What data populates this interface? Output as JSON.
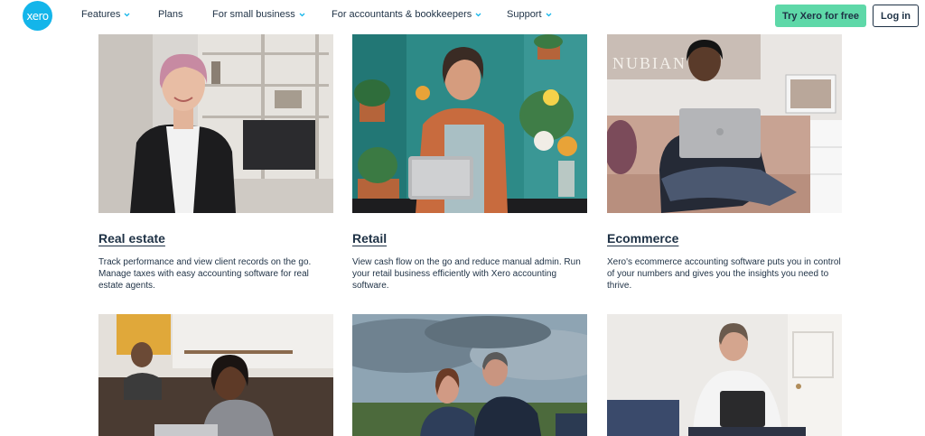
{
  "nav": {
    "logo": "xero",
    "items": [
      {
        "label": "Features",
        "has_dropdown": true
      },
      {
        "label": "Plans",
        "has_dropdown": false
      },
      {
        "label": "For small business",
        "has_dropdown": true
      },
      {
        "label": "For accountants & bookkeepers",
        "has_dropdown": true
      },
      {
        "label": "Support",
        "has_dropdown": true
      }
    ],
    "try_button": "Try Xero for free",
    "login_button": "Log in"
  },
  "cards": [
    {
      "title": "Real estate",
      "description": "Track performance and view client records on the go. Manage taxes with easy accounting software for real estate agents."
    },
    {
      "title": "Retail",
      "description": "View cash flow on the go and reduce manual admin. Run your retail business efficiently with Xero accounting software."
    },
    {
      "title": "Ecommerce",
      "description": "Xero's ecommerce accounting software puts you in control of your numbers and gives you the insights you need to thrive.",
      "image_sign_text": "NUBIAN"
    }
  ],
  "colors": {
    "brand_blue": "#13b5ea",
    "cta_green": "#5ed8a8",
    "text_navy": "#1e3145"
  }
}
